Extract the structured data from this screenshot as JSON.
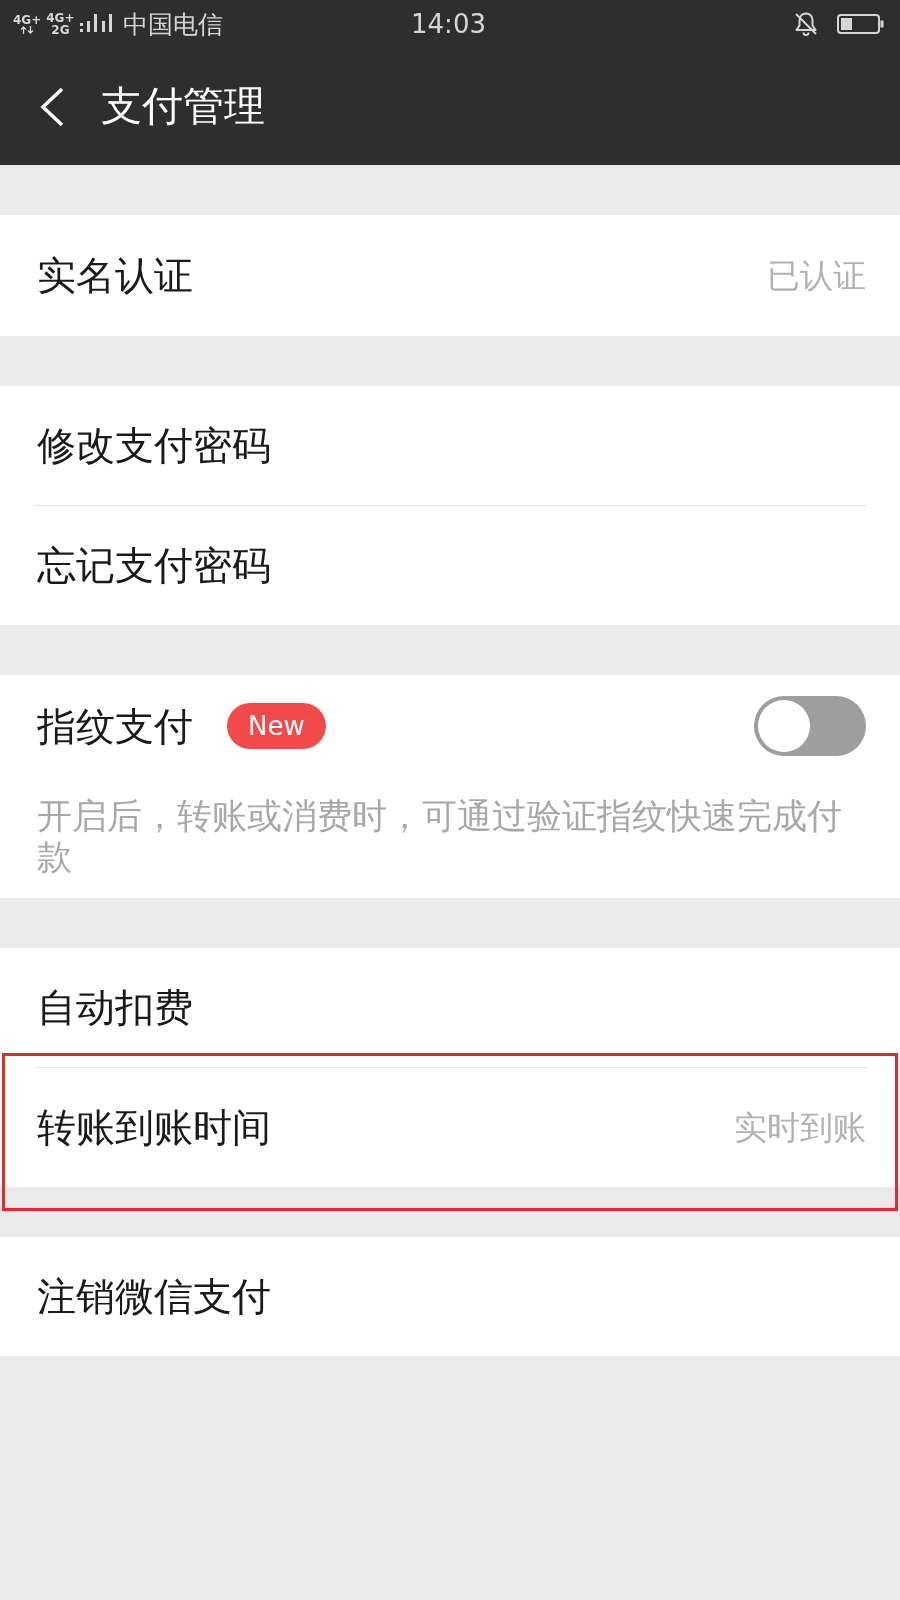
{
  "status_bar": {
    "network_labels": [
      "4G+",
      "4G+",
      "2G"
    ],
    "carrier": "中国电信",
    "time": "14:03"
  },
  "nav_bar": {
    "title": "支付管理"
  },
  "groups": [
    {
      "items": [
        {
          "kind": "link",
          "label": "实名认证",
          "value": "已认证",
          "highlighted": false
        }
      ]
    },
    {
      "items": [
        {
          "kind": "link",
          "label": "修改支付密码",
          "highlighted": false
        },
        {
          "kind": "link",
          "label": "忘记支付密码",
          "highlighted": false
        }
      ]
    },
    {
      "items": [
        {
          "kind": "toggle",
          "label": "指纹支付",
          "badge": "New",
          "on": false,
          "description": "开启后，转账或消费时，可通过验证指纹快速完成付款",
          "highlighted": false
        }
      ]
    },
    {
      "items": [
        {
          "kind": "link",
          "label": "自动扣费",
          "highlighted": false
        },
        {
          "kind": "link",
          "label": "转账到账时间",
          "value": "实时到账",
          "highlighted": true
        }
      ]
    },
    {
      "items": [
        {
          "kind": "link",
          "label": "注销微信支付",
          "highlighted": false
        }
      ]
    }
  ]
}
